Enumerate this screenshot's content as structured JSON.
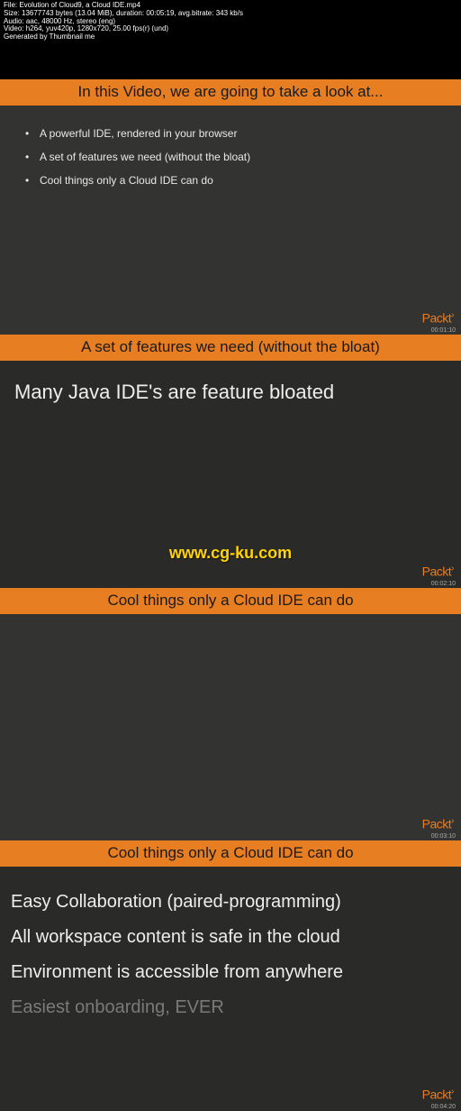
{
  "metadata": {
    "line1": "File: Evolution of Cloud9, a Cloud IDE.mp4",
    "line2": "Size: 13677743 bytes (13.04 MiB), duration: 00:05:19, avg.bitrate: 343 kb/s",
    "line3": "Audio: aac, 48000 Hz, stereo (eng)",
    "line4": "Video: h264, yuv420p, 1280x720, 25.00 fps(r) (und)",
    "line5": "Generated by Thumbnail me"
  },
  "slide1": {
    "header": "In this Video, we are going to take a look at...",
    "bullets": [
      "A powerful IDE, rendered in your browser",
      "A set of features we need (without the bloat)",
      "Cool things only a Cloud IDE can do"
    ],
    "brand": "Packt",
    "timestamp": "00:01:10"
  },
  "slide2": {
    "header": "A set of features we need (without the bloat)",
    "body": "Many Java IDE's are feature bloated",
    "watermark": "www.cg-ku.com",
    "brand": "Packt",
    "timestamp": "00:02:10"
  },
  "slide3": {
    "header": "Cool things only a Cloud IDE can do",
    "brand": "Packt",
    "timestamp": "00:03:10"
  },
  "slide4": {
    "header": "Cool things only a Cloud IDE can do",
    "items": [
      "Easy Collaboration (paired-programming)",
      "All workspace content is safe in the cloud",
      "Environment is accessible from anywhere",
      "Easiest onboarding, EVER"
    ],
    "brand": "Packt",
    "timestamp": "00:04:20"
  }
}
